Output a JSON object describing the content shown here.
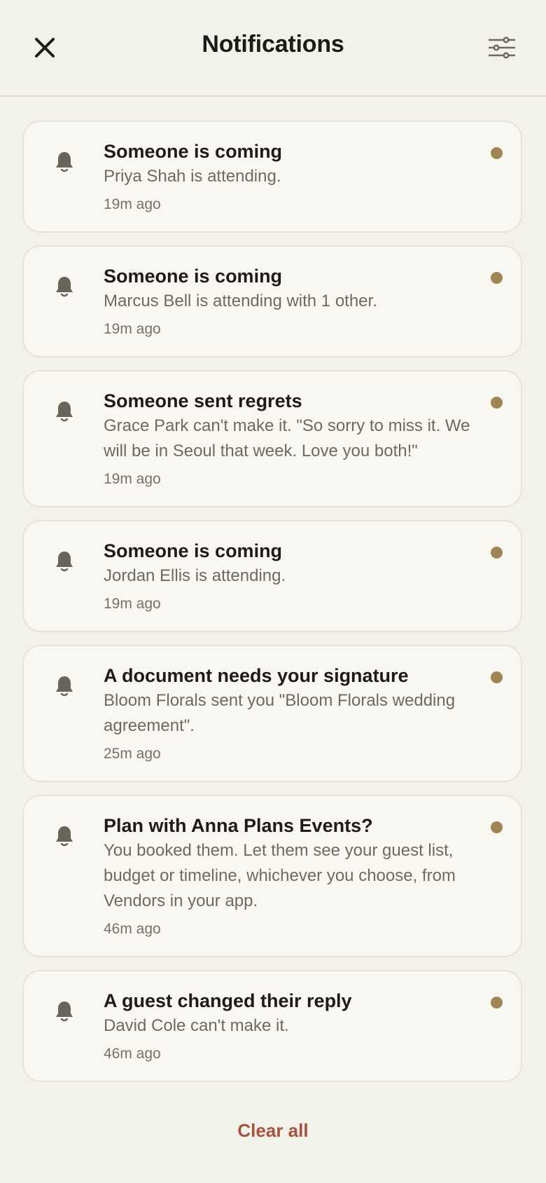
{
  "header": {
    "title": "Notifications",
    "close_icon": "close-icon",
    "filter_icon": "sliders-icon"
  },
  "colors": {
    "background": "#f3f2ea",
    "card": "#f8f7f1",
    "unread_dot": "#a08654",
    "clear_all": "#a5533f"
  },
  "notifications": [
    {
      "title": "Someone is coming",
      "body": "Priya Shah is attending.",
      "time": "19m ago",
      "unread": true,
      "icon": "bell-icon"
    },
    {
      "title": "Someone is coming",
      "body": "Marcus Bell is attending with 1 other.",
      "time": "19m ago",
      "unread": true,
      "icon": "bell-icon"
    },
    {
      "title": "Someone sent regrets",
      "body": "Grace Park can't make it. \"So sorry to miss it. We will be in Seoul that week. Love you both!\"",
      "time": "19m ago",
      "unread": true,
      "icon": "bell-icon"
    },
    {
      "title": "Someone is coming",
      "body": "Jordan Ellis is attending.",
      "time": "19m ago",
      "unread": true,
      "icon": "bell-icon"
    },
    {
      "title": "A document needs your signature",
      "body": "Bloom Florals sent you \"Bloom Florals wedding agreement\".",
      "time": "25m ago",
      "unread": true,
      "icon": "bell-icon"
    },
    {
      "title": "Plan with Anna Plans Events?",
      "body": "You booked them. Let them see your guest list, budget or timeline, whichever you choose, from Vendors in your app.",
      "time": "46m ago",
      "unread": true,
      "icon": "bell-icon"
    },
    {
      "title": "A guest changed their reply",
      "body": "David Cole can't make it.",
      "time": "46m ago",
      "unread": true,
      "icon": "bell-icon"
    }
  ],
  "footer": {
    "clear_all_label": "Clear all"
  }
}
